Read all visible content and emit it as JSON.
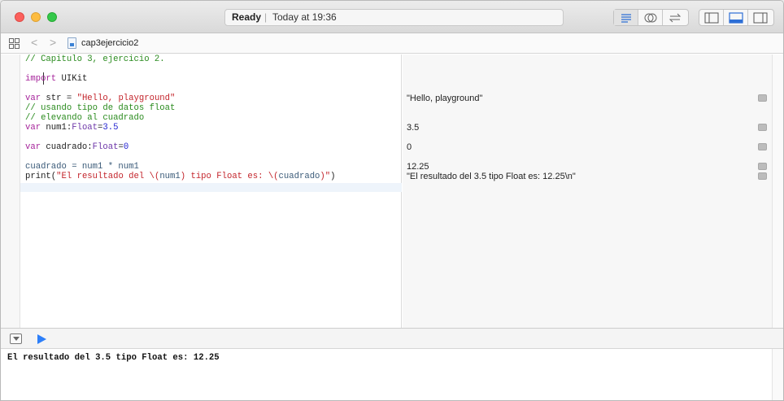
{
  "titlebar": {
    "status_ready": "Ready",
    "status_separator": "|",
    "status_time": "Today at 19:36",
    "traffic_colors": {
      "close": "#fc605c",
      "minimize": "#fdbc40",
      "maximize": "#34c84a"
    },
    "toolbar_icons": [
      "standard-editor-icon",
      "assistant-editor-icon",
      "version-editor-icon",
      "navigator-toggle-icon",
      "debug-area-toggle-icon",
      "utilities-toggle-icon"
    ]
  },
  "jumpbar": {
    "back": "<",
    "forward": ">",
    "file_name": "cap3ejercicio2"
  },
  "editor": {
    "lines": [
      {
        "tokens": [
          {
            "t": "// Capitulo 3, ejercicio 2.",
            "c": "c-comment"
          }
        ]
      },
      {
        "tokens": [
          {
            "t": "import",
            "c": "c-kw"
          },
          {
            "t": " UIKit",
            "c": ""
          }
        ]
      },
      {
        "tokens": [
          {
            "t": "var",
            "c": "c-kw"
          },
          {
            "t": " str = ",
            "c": ""
          },
          {
            "t": "\"Hello, playground\"",
            "c": "c-str"
          }
        ]
      },
      {
        "tokens": [
          {
            "t": "// usando tipo de datos float",
            "c": "c-comment"
          }
        ]
      },
      {
        "tokens": [
          {
            "t": "// elevando al cuadrado",
            "c": "c-comment"
          }
        ]
      },
      {
        "tokens": [
          {
            "t": "var",
            "c": "c-kw"
          },
          {
            "t": " num1:",
            "c": ""
          },
          {
            "t": "Float",
            "c": "c-type"
          },
          {
            "t": "=",
            "c": ""
          },
          {
            "t": "3.5",
            "c": "c-num"
          }
        ]
      },
      {
        "tokens": [
          {
            "t": "var",
            "c": "c-kw"
          },
          {
            "t": " cuadrado:",
            "c": ""
          },
          {
            "t": "Float",
            "c": "c-type"
          },
          {
            "t": "=",
            "c": ""
          },
          {
            "t": "0",
            "c": "c-num"
          }
        ]
      },
      {
        "tokens": [
          {
            "t": "cuadrado = num1 * num1",
            "c": "c-ident"
          }
        ]
      },
      {
        "tokens": [
          {
            "t": "print(",
            "c": ""
          },
          {
            "t": "\"El resultado del \\(",
            "c": "c-str"
          },
          {
            "t": "num1",
            "c": "c-ident"
          },
          {
            "t": ") tipo Float es: \\(",
            "c": "c-str"
          },
          {
            "t": "cuadrado",
            "c": "c-ident"
          },
          {
            "t": ")\"",
            "c": "c-str"
          },
          {
            "t": ")",
            "c": ""
          }
        ]
      }
    ]
  },
  "results": [
    "\"Hello, playground\"",
    "3.5",
    "0",
    "12.25",
    "\"El resultado del 3.5 tipo Float es: 12.25\\n\""
  ],
  "console": {
    "output": "El resultado del 3.5 tipo Float es: 12.25"
  }
}
